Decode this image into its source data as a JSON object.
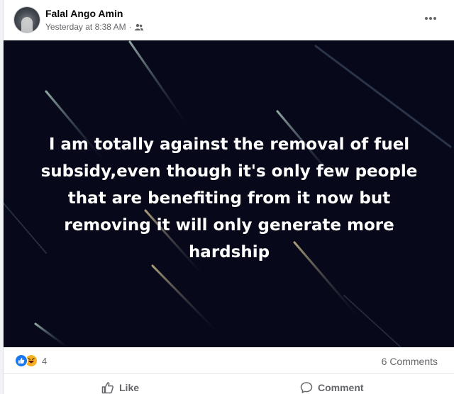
{
  "post": {
    "author": "Falal Ango Amin",
    "timestamp": "Yesterday at 8:38 AM",
    "separator": "·",
    "audience_icon": "friends-icon",
    "more_icon": "more-options-icon",
    "text": "I am totally against the removal of fuel subsidy,even though it's only few people that are benefiting from it now but removing it will only generate more hardship",
    "background_color": "#07091a"
  },
  "reactions": {
    "types": [
      "like",
      "haha"
    ],
    "count": "4",
    "comments": "6 Comments"
  },
  "actions": {
    "like_label": "Like",
    "comment_label": "Comment"
  },
  "colors": {
    "like_blue": "#1877f2",
    "haha_yellow": "#f7b125",
    "secondary_text": "#65676b"
  }
}
